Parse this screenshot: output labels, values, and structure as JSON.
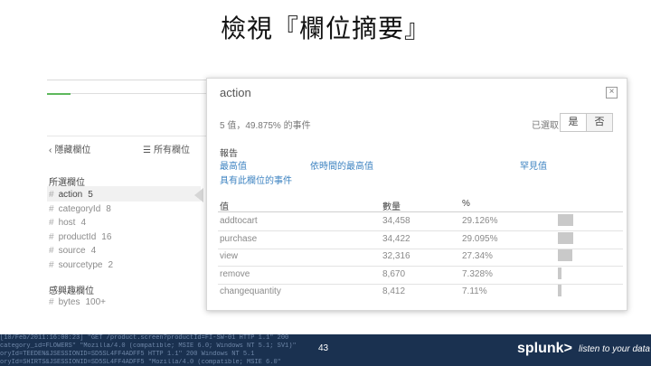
{
  "slide": {
    "title": "檢視『欄位摘要』",
    "page_number": "43"
  },
  "sidebar": {
    "hide_fields_label": "隱藏欄位",
    "all_fields_label": "所有欄位",
    "selected_header": "所選欄位",
    "selected_fields": [
      {
        "name": "action",
        "count": "5"
      },
      {
        "name": "categoryId",
        "count": "8"
      },
      {
        "name": "host",
        "count": "4"
      },
      {
        "name": "productId",
        "count": "16"
      },
      {
        "name": "source",
        "count": "4"
      },
      {
        "name": "sourcetype",
        "count": "2"
      }
    ],
    "interesting_header": "感興趣欄位",
    "interesting_fields": [
      {
        "name": "bytes",
        "count": "100+"
      }
    ]
  },
  "panel": {
    "field_name": "action",
    "summary": "5 值，49.875% 的事件",
    "selected_label": "已選取",
    "toggle_yes": "是",
    "toggle_no": "否",
    "reports_header": "報告",
    "links": {
      "top_values": "最高值",
      "top_values_by_time": "依時間的最高值",
      "rare_values": "罕見值",
      "events_with_field": "具有此欄位的事件"
    },
    "columns": {
      "value": "值",
      "count": "數量",
      "percent": "%"
    },
    "rows": [
      {
        "value": "addtocart",
        "count": "34,458",
        "percent": "29.126%",
        "fraction": 0.29126
      },
      {
        "value": "purchase",
        "count": "34,422",
        "percent": "29.095%",
        "fraction": 0.29095
      },
      {
        "value": "view",
        "count": "32,316",
        "percent": "27.34%",
        "fraction": 0.2734
      },
      {
        "value": "remove",
        "count": "8,670",
        "percent": "7.328%",
        "fraction": 0.07328
      },
      {
        "value": "changequantity",
        "count": "8,412",
        "percent": "7.11%",
        "fraction": 0.0711
      }
    ]
  },
  "footer": {
    "logo": "splunk>",
    "tagline": "listen to your data",
    "log_lines": [
      "[10/Feb/2011:16:00:23] \"GET /product.screen?productId=FI-SW-01 HTTP 1.1\" 200",
      "category_id=FLOWERS\" \"Mozilla/4.0 (compatible; MSIE 6.0; Windows NT 5.1; SV1)\"",
      "oryId=TEEDEN&JSESSIONID=SD5SL4FF4ADFF5 HTTP 1.1\" 200 Windows NT 5.1",
      "oryId=SHIRTS&JSESSIONID=SD5SL4FF4ADFF5 \"Mozilla/4.0 (compatible; MSIE 6.0\""
    ],
    "colors": {
      "band": "#1a3150",
      "text": "#ffffff"
    }
  }
}
